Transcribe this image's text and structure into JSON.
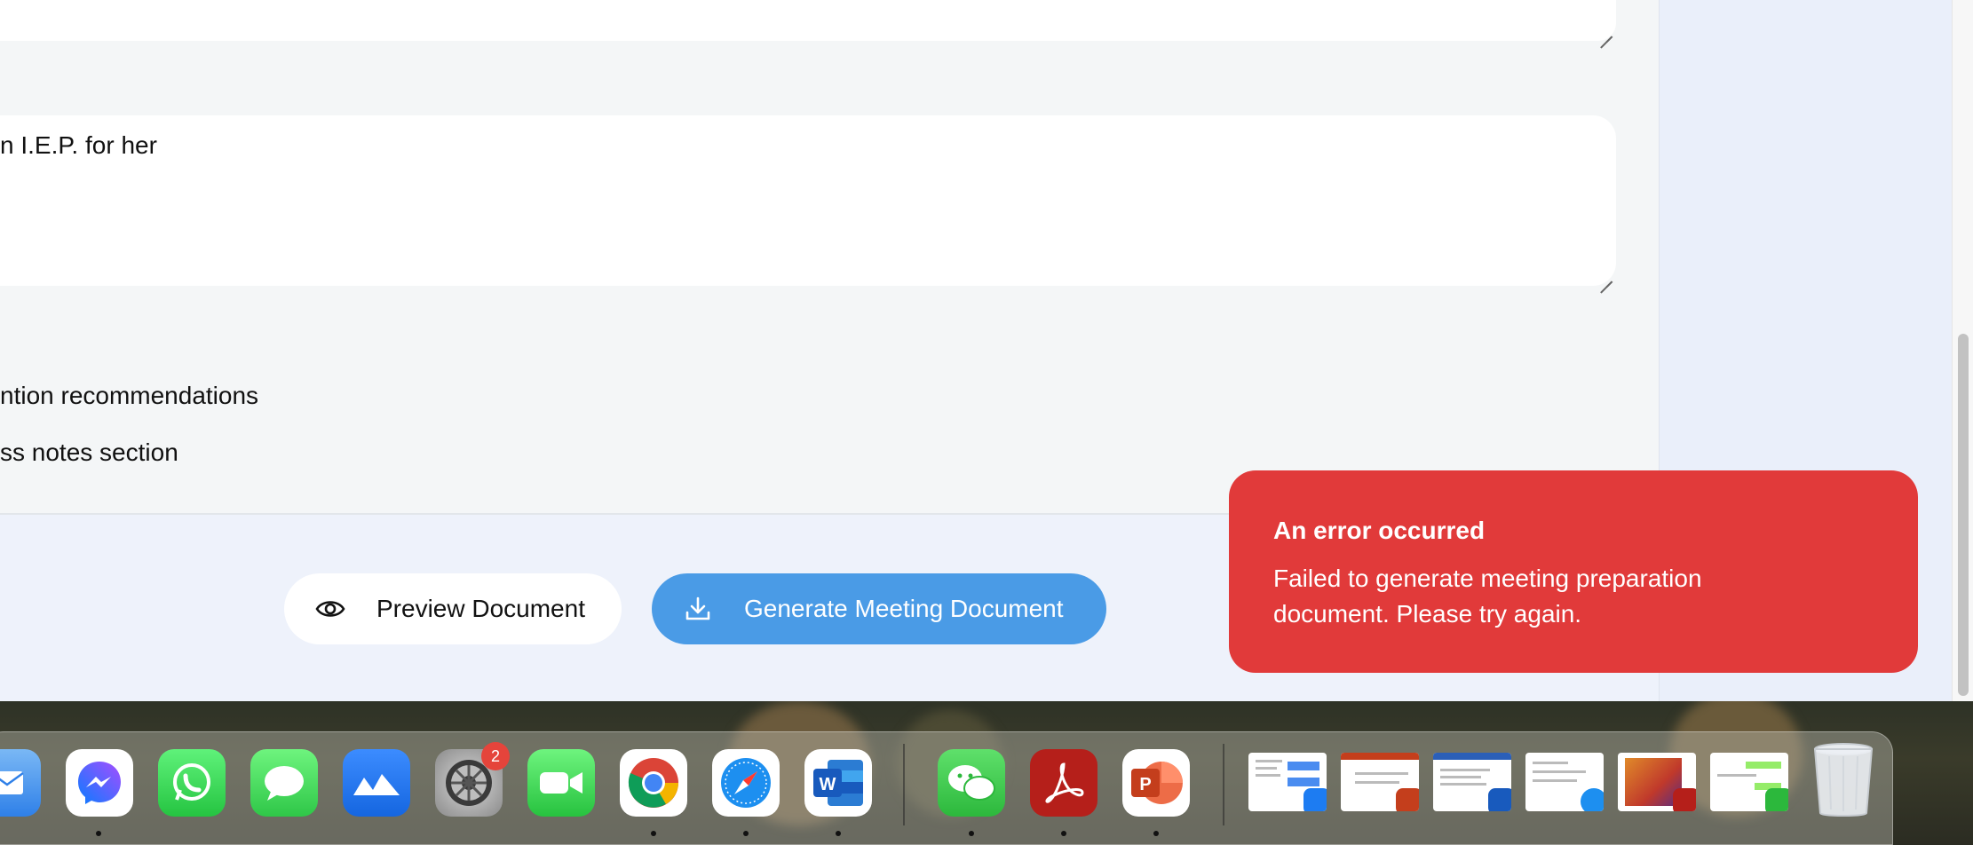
{
  "form": {
    "textarea_value_fragment": "n I.E.P. for her",
    "checklist": [
      "ntion recommendations",
      "ss notes section"
    ]
  },
  "actions": {
    "preview_label": "Preview Document",
    "generate_label": "Generate Meeting Document"
  },
  "toast": {
    "title": "An error occurred",
    "message": "Failed to generate meeting preparation document. Please try again."
  },
  "dock": {
    "apps": [
      {
        "name": "mail-icon",
        "running": false
      },
      {
        "name": "messenger-icon",
        "running": true
      },
      {
        "name": "whatsapp-icon",
        "running": false
      },
      {
        "name": "messages-icon",
        "running": false
      },
      {
        "name": "collaboration-app-icon",
        "running": false
      },
      {
        "name": "system-settings-icon",
        "running": false,
        "badge": "2"
      },
      {
        "name": "facetime-icon",
        "running": false
      },
      {
        "name": "chrome-icon",
        "running": true
      },
      {
        "name": "safari-icon",
        "running": true
      },
      {
        "name": "word-icon",
        "running": true
      },
      {
        "name": "wechat-icon",
        "running": true
      },
      {
        "name": "acrobat-icon",
        "running": true
      },
      {
        "name": "powerpoint-icon",
        "running": true
      }
    ],
    "windows": [
      "messenger-window-thumbnail",
      "powerpoint-window-thumbnail",
      "word-window-thumbnail",
      "safari-window-thumbnail",
      "acrobat-window-thumbnail",
      "wechat-window-thumbnail"
    ],
    "trash": "trash-icon"
  },
  "colors": {
    "primary": "#4a9be6",
    "error": "#e13a3a",
    "page_bg": "#eef2fb",
    "card_bg": "#f4f6f7"
  }
}
